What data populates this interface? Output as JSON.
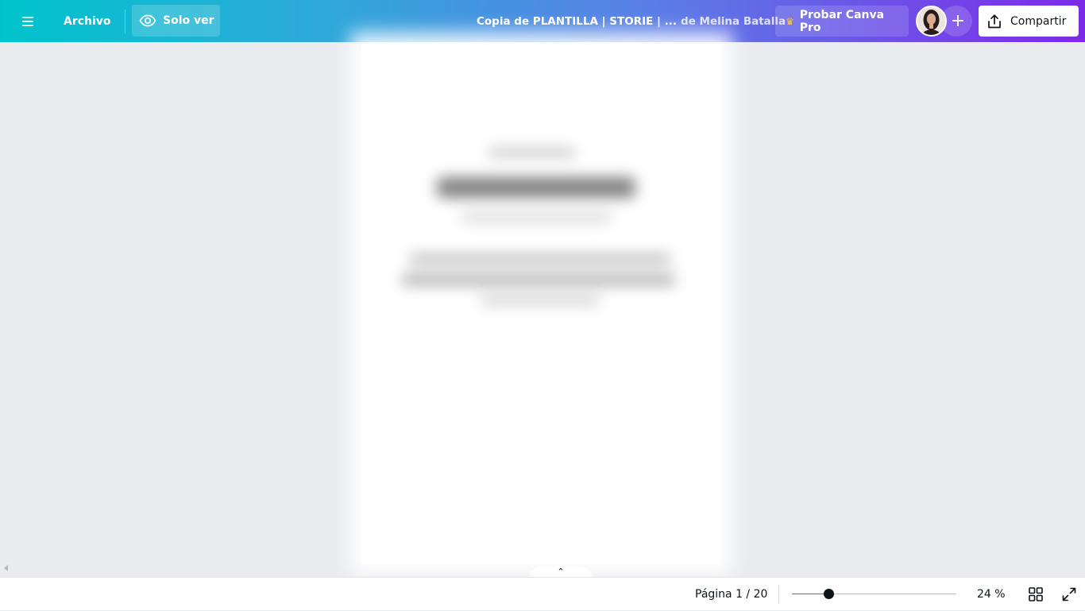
{
  "topbar": {
    "menu_icon": "hamburger-menu-icon",
    "file_label": "Archivo",
    "view_mode_label": "Solo ver",
    "view_mode_icon": "eye-icon",
    "document_title": "Copia de PLANTILLA | STORIE | ...",
    "document_author": "de Melina Batalla",
    "pro_label": "Probar Canva Pro",
    "pro_icon": "crown-icon",
    "add_collaborator_symbol": "+",
    "share_label": "Compartir",
    "share_icon": "upload-icon",
    "gradient_colors": [
      "#00c4cc",
      "#7d2ae8"
    ]
  },
  "canvas": {
    "background": "#ebecf0",
    "collapse_symbol": "⌃"
  },
  "bottombar": {
    "page_indicator": "Página 1 / 20",
    "zoom_fraction": 0.22,
    "zoom_label": "24 %",
    "grid_icon": "grid-view-icon",
    "fullscreen_icon": "expand-icon"
  }
}
